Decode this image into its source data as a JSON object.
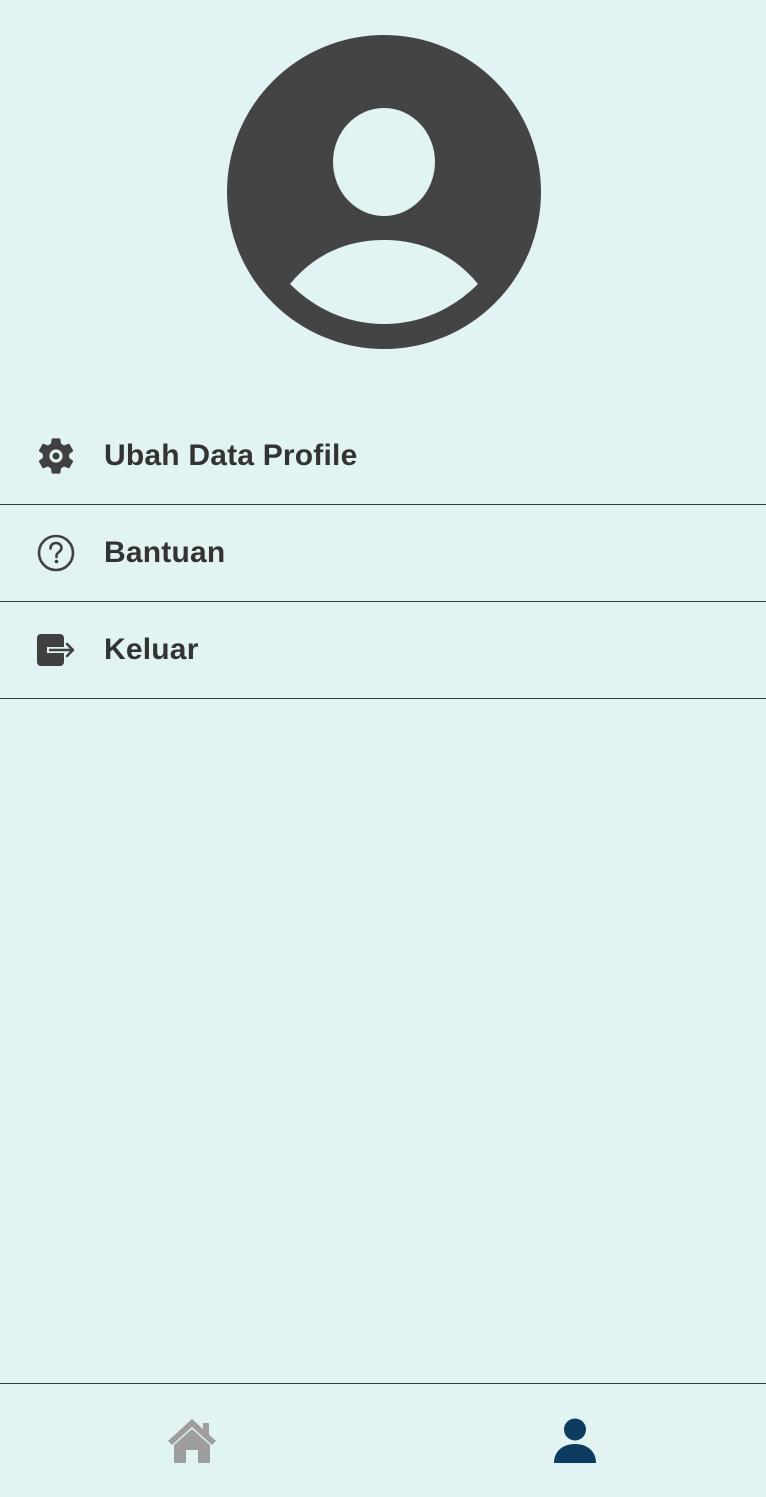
{
  "colors": {
    "background": "#e1f3f3",
    "text": "#333333",
    "icon": "#404040",
    "avatar": "#444444",
    "divider": "#3a3a3a",
    "nav_inactive": "#9e9e9e",
    "nav_active": "#0d3c61"
  },
  "profile": {
    "avatar_icon": "account-circle-icon"
  },
  "menu": {
    "items": [
      {
        "label": "Ubah Data Profile",
        "icon": "gear-icon"
      },
      {
        "label": "Bantuan",
        "icon": "help-circle-icon"
      },
      {
        "label": "Keluar",
        "icon": "logout-icon"
      }
    ]
  },
  "bottom_nav": {
    "items": [
      {
        "icon": "home-icon",
        "active": false
      },
      {
        "icon": "person-icon",
        "active": true
      }
    ]
  }
}
